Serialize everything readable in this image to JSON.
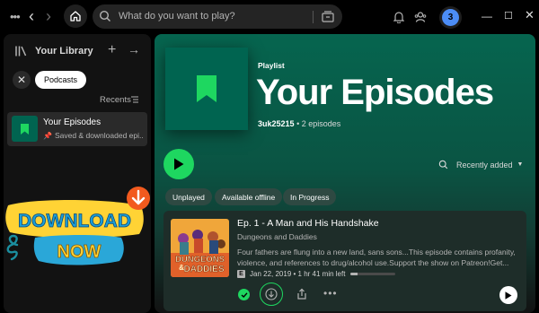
{
  "topbar": {
    "search_placeholder": "What do you want to play?",
    "avatar_initial": "3"
  },
  "library": {
    "title": "Your Library",
    "filter_chip": "Podcasts",
    "sort_label": "Recents",
    "items": [
      {
        "name": "Your Episodes",
        "subtitle": "Saved & downloaded epi..."
      }
    ]
  },
  "overlay": {
    "line1": "DOWNLOAD",
    "line2": "NOW"
  },
  "playlist": {
    "type_label": "Playlist",
    "title": "Your Episodes",
    "owner": "3uk25215",
    "count_text": "• 2 episodes",
    "sort_label": "Recently added",
    "filters": [
      "Unplayed",
      "Available offline",
      "In Progress"
    ]
  },
  "episodes": [
    {
      "title": "Ep. 1 - A Man and His Handshake",
      "show": "Dungeons and Daddies",
      "description": "Four fathers are flung into a new land, sans sons...This episode contains profanity, violence, and references to drug/alcohol use.Support the show on Patreon!Get...",
      "explicit_badge": "E",
      "date": "Jan 22, 2019",
      "duration_left": "• 1 hr 41 min left",
      "progress_fraction": 0.15,
      "art_line1": "DUNGEONS",
      "art_line2": "DADDIES",
      "art_amp": "&"
    }
  ],
  "colors": {
    "accent": "#1ed760",
    "header_green": "#06654f",
    "cover_green": "#006450"
  }
}
